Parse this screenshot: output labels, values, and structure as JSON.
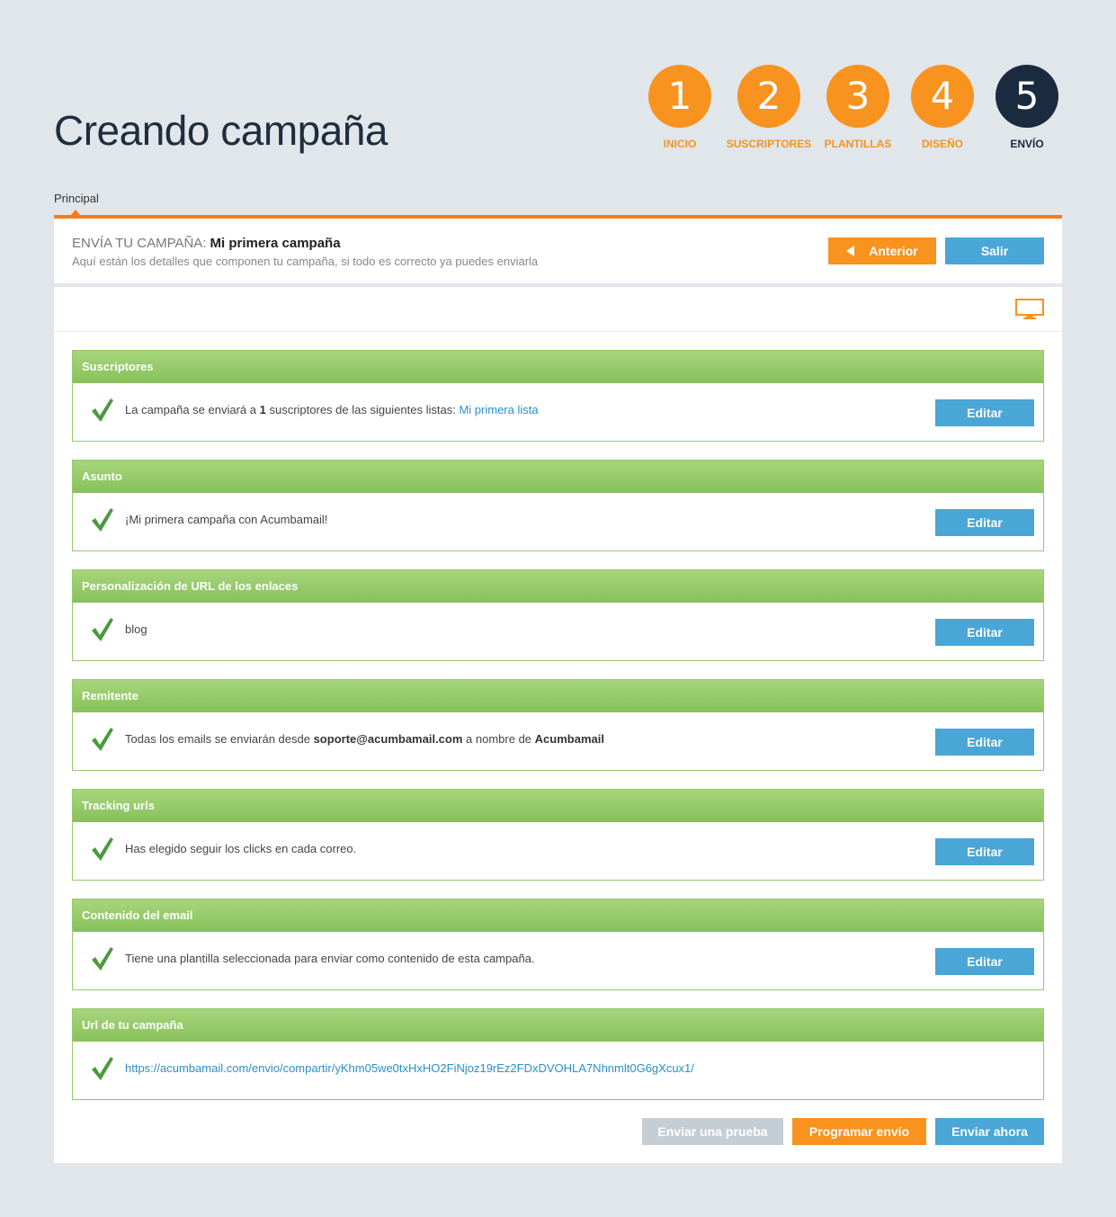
{
  "page": {
    "title": "Creando campaña"
  },
  "steps": [
    {
      "number": "1",
      "label": "INICIO"
    },
    {
      "number": "2",
      "label": "SUSCRIPTORES"
    },
    {
      "number": "3",
      "label": "PLANTILLAS"
    },
    {
      "number": "4",
      "label": "DISEÑO"
    },
    {
      "number": "5",
      "label": "ENVÍO"
    }
  ],
  "tab": {
    "label": "Principal"
  },
  "header": {
    "prefix": "ENVÍA TU CAMPAÑA:",
    "campaign_name": "Mi primera campaña",
    "subtitle": "Aquí están los detalles que componen tu campaña, si todo es correcto ya puedes enviarla",
    "anterior_label": "Anterior",
    "salir_label": "Salir"
  },
  "toolbar": {
    "preview_icon": "monitor-icon"
  },
  "sections": {
    "suscriptores": {
      "title": "Suscriptores",
      "text_before": "La campaña se enviará a",
      "count": "1",
      "text_after": "suscriptores de las siguientes listas:",
      "list_link": "Mi primera lista",
      "edit_label": "Editar"
    },
    "asunto": {
      "title": "Asunto",
      "text": "¡Mi primera campaña con Acumbamail!",
      "edit_label": "Editar"
    },
    "personalizacion": {
      "title": "Personalización de URL de los enlaces",
      "text": "blog",
      "edit_label": "Editar"
    },
    "remitente": {
      "title": "Remitente",
      "text_before": "Todas los emails se enviarán desde",
      "email": "soporte@acumbamail.com",
      "text_middle": "a nombre de",
      "sender_name": "Acumbamail",
      "edit_label": "Editar"
    },
    "tracking": {
      "title": "Tracking urls",
      "text": "Has elegido seguir los clicks en cada correo.",
      "edit_label": "Editar"
    },
    "contenido": {
      "title": "Contenido del email",
      "text": "Tiene una plantilla seleccionada para enviar como contenido de esta campaña.",
      "edit_label": "Editar"
    },
    "url": {
      "title": "Url de tu campaña",
      "link": "https://acumbamail.com/envio/compartir/yKhm05we0txHxHO2FiNjoz19rEz2FDxDVOHLA7Nhnmlt0G6gXcux1/"
    }
  },
  "footer": {
    "prueba_label": "Enviar una prueba",
    "programar_label": "Programar envío",
    "ahora_label": "Enviar ahora"
  },
  "colors": {
    "accent": "#f7931e",
    "primary": "#4aa6d6",
    "dark": "#1b2b3f",
    "section_green": "#96c96b"
  }
}
